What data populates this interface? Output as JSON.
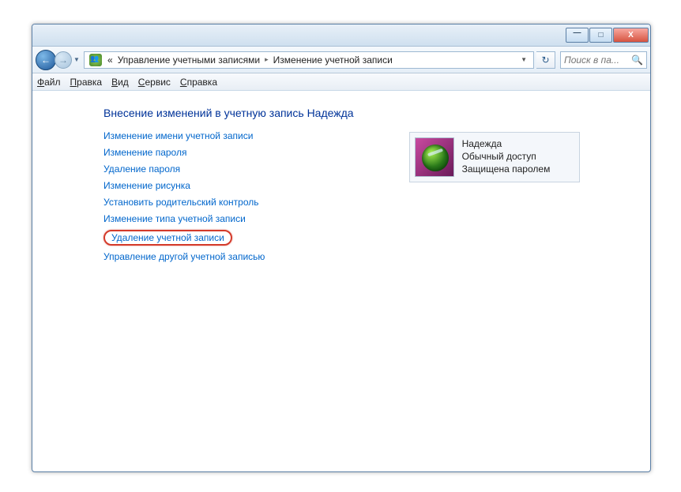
{
  "titlebar": {
    "min": "—",
    "max": "□",
    "close": "X"
  },
  "nav": {
    "back": "←",
    "forward": "→",
    "dropdown": "▼"
  },
  "address": {
    "chevrons": "«",
    "segment1": "Управление учетными записями",
    "segment2": "Изменение учетной записи",
    "arrow": "▸",
    "dropdown": "▼"
  },
  "refresh": "↻",
  "search": {
    "placeholder": "Поиск в па...",
    "icon": "🔍"
  },
  "menu": {
    "file": {
      "u": "Ф",
      "rest": "айл"
    },
    "edit": {
      "u": "П",
      "rest": "равка"
    },
    "view": {
      "u": "В",
      "rest": "ид"
    },
    "tools": {
      "u": "С",
      "rest": "ервис"
    },
    "help": {
      "u": "С",
      "rest": "правка"
    }
  },
  "heading": "Внесение изменений в учетную запись Надежда",
  "links": {
    "l0": "Изменение имени учетной записи",
    "l1": "Изменение пароля",
    "l2": "Удаление пароля",
    "l3": "Изменение рисунка",
    "l4": "Установить родительский контроль",
    "l5": "Изменение типа учетной записи",
    "l6": "Удаление учетной записи",
    "l7": "Управление другой учетной записью"
  },
  "account": {
    "name": "Надежда",
    "type": "Обычный доступ",
    "protected": "Защищена паролем"
  }
}
